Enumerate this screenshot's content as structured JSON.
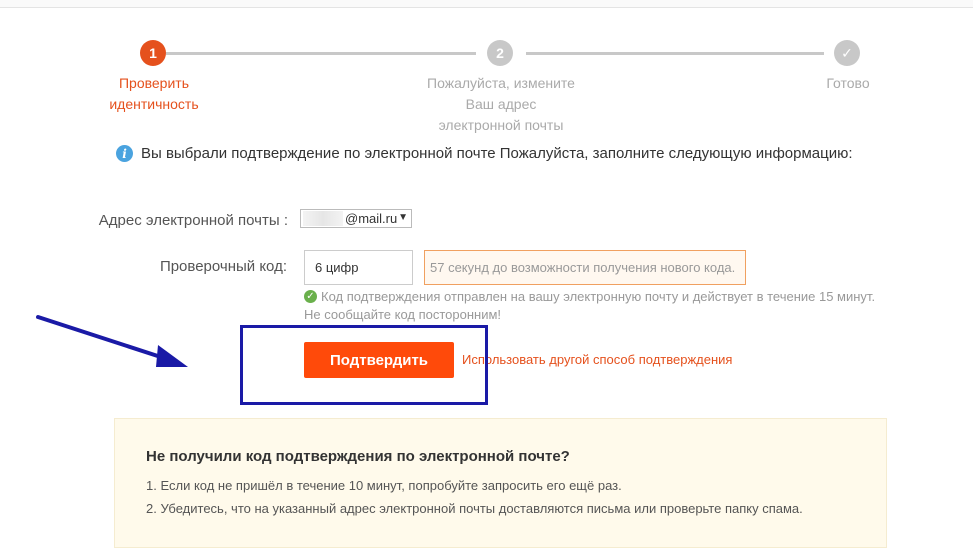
{
  "steps": [
    {
      "number": "1",
      "label_lines": [
        "Проверить",
        "идентичность"
      ],
      "state": "active"
    },
    {
      "number": "2",
      "label_lines": [
        "Пожалуйста, измените",
        "Ваш адрес",
        "электронной почты"
      ],
      "state": "pending"
    },
    {
      "number": "✓",
      "label_lines": [
        "Готово"
      ],
      "state": "pending"
    }
  ],
  "colors": {
    "accent": "#ff4a0a",
    "step_active": "#e5511d",
    "step_pending": "#c8c8c8",
    "annotation": "#1a1aa6",
    "success": "#6ab04c",
    "info": "#4aa3df"
  },
  "info": {
    "icon": "info-icon",
    "text": "Вы выбрали подтверждение по электронной почте Пожалуйста, заполните следующую информацию:"
  },
  "form": {
    "email_label": "Адрес электронной почты :",
    "email_domain": "@mail.ru",
    "code_label": "Проверочный код:",
    "code_placeholder": "6 цифр",
    "timer_text": "57 секунд до возможности получения нового кода.",
    "sent_icon": "check-circle-icon",
    "sent_text": "Код подтверждения отправлен на вашу электронную почту и действует в течение 15 минут.",
    "no_share_text": "Не сообщайте код посторонним!"
  },
  "actions": {
    "confirm_label": "Подтвердить",
    "other_method_label": "Использовать другой способ подтверждения"
  },
  "help": {
    "title": "Не получили код подтверждения по электронной почте?",
    "items": [
      "1. Если код не пришёл в течение 10 минут, попробуйте запросить его ещё раз.",
      "2. Убедитесь, что на указанный адрес электронной почты доставляются письма или проверьте папку спама."
    ]
  }
}
